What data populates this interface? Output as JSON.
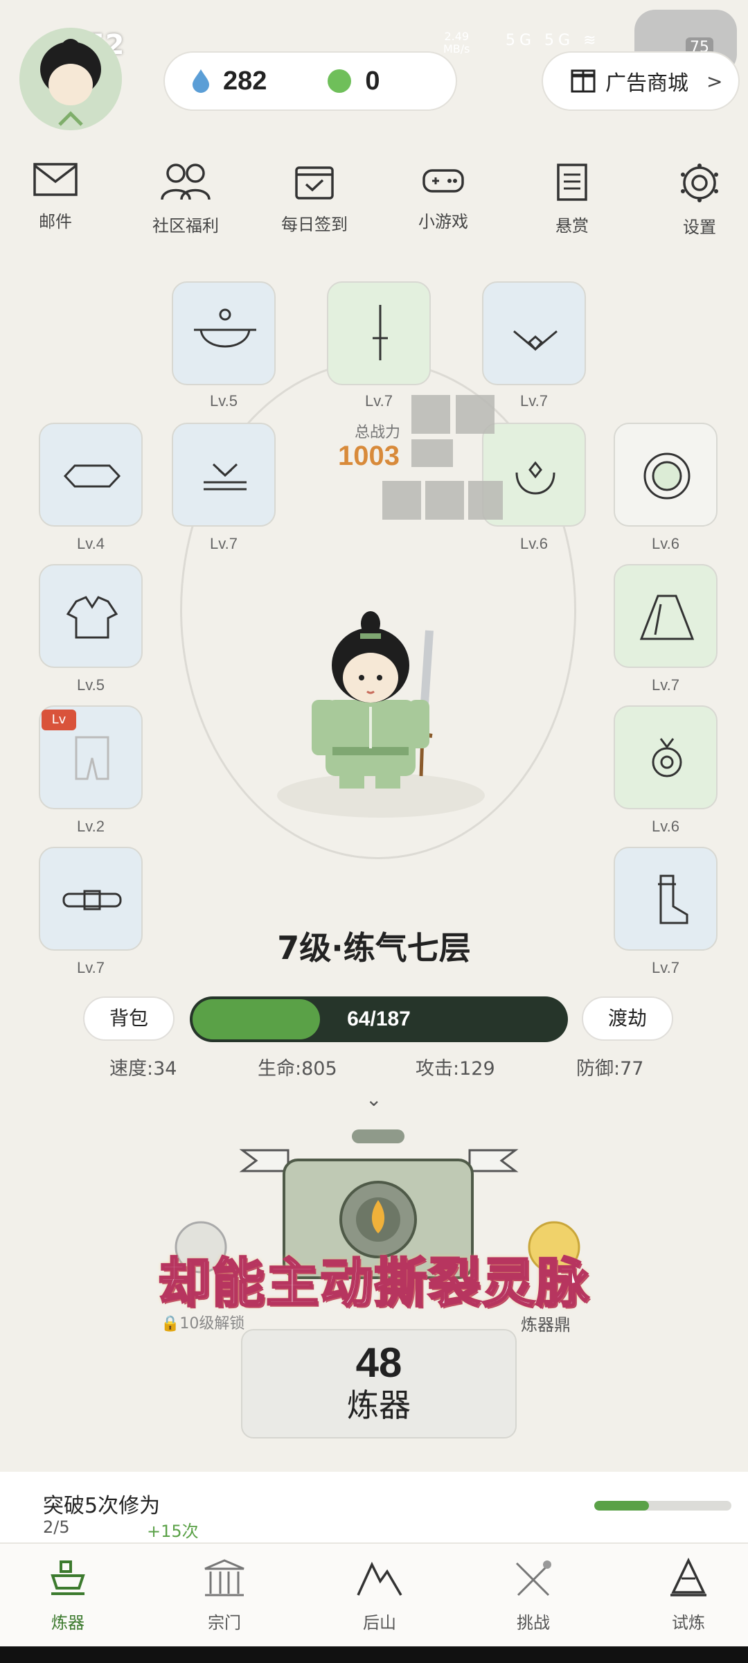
{
  "status": {
    "time": "0:52",
    "speed": "2.49\nMB/s",
    "net1": "5G",
    "net2": "5G",
    "battery": "75"
  },
  "currency": {
    "spirit_stones": "282",
    "jade": "0"
  },
  "shop": {
    "label": "广告商城",
    "arrow": ">"
  },
  "menu": [
    {
      "label": "邮件",
      "icon": "mail-icon"
    },
    {
      "label": "社区福利",
      "icon": "community-icon"
    },
    {
      "label": "每日签到",
      "icon": "checkin-icon"
    },
    {
      "label": "小游戏",
      "icon": "gamepad-icon"
    },
    {
      "label": "悬赏",
      "icon": "bounty-icon"
    },
    {
      "label": "设置",
      "icon": "settings-icon"
    }
  ],
  "equipment": {
    "top_left": "Lv.5",
    "top_center": "Lv.7",
    "top_right": "Lv.7",
    "left_1": "Lv.4",
    "left_2": "Lv.7",
    "right_inner": "Lv.6",
    "right_1": "Lv.6",
    "left_3": "Lv.5",
    "right_2": "Lv.7",
    "left_4": "Lv.2",
    "left_4_badge": "Lv",
    "right_3": "Lv.6",
    "left_5": "Lv.7",
    "right_4": "Lv.7"
  },
  "power": {
    "label": "总战力",
    "value": "1003"
  },
  "character": {
    "realm": "7级·练气七层"
  },
  "actions": {
    "bag": "背包",
    "tribulation": "渡劫"
  },
  "exp": {
    "text": "64/187",
    "current": 64,
    "max": 187
  },
  "stats": {
    "speed": "速度:34",
    "hp": "生命:805",
    "attack": "攻击:129",
    "defense": "防御:77"
  },
  "subtitle": "却能主动撕裂灵脉",
  "forge": {
    "unlock": "10级解锁",
    "cauldron": "炼器鼎",
    "count": "48",
    "label": "炼器"
  },
  "task": {
    "title": "突破5次修为",
    "progress": "2/5",
    "bonus": "+15次",
    "fraction": 0.4
  },
  "nav": [
    {
      "label": "炼器",
      "icon": "forge-icon",
      "active": true
    },
    {
      "label": "宗门",
      "icon": "sect-icon",
      "active": false
    },
    {
      "label": "后山",
      "icon": "mountain-icon",
      "active": false
    },
    {
      "label": "挑战",
      "icon": "swords-icon",
      "active": false
    },
    {
      "label": "试炼",
      "icon": "trial-icon",
      "active": false
    }
  ],
  "colors": {
    "accent": "#5aa147",
    "power": "#d88a3a",
    "bar_bg": "#26352a",
    "subtitle_stroke": "#b7355f"
  }
}
